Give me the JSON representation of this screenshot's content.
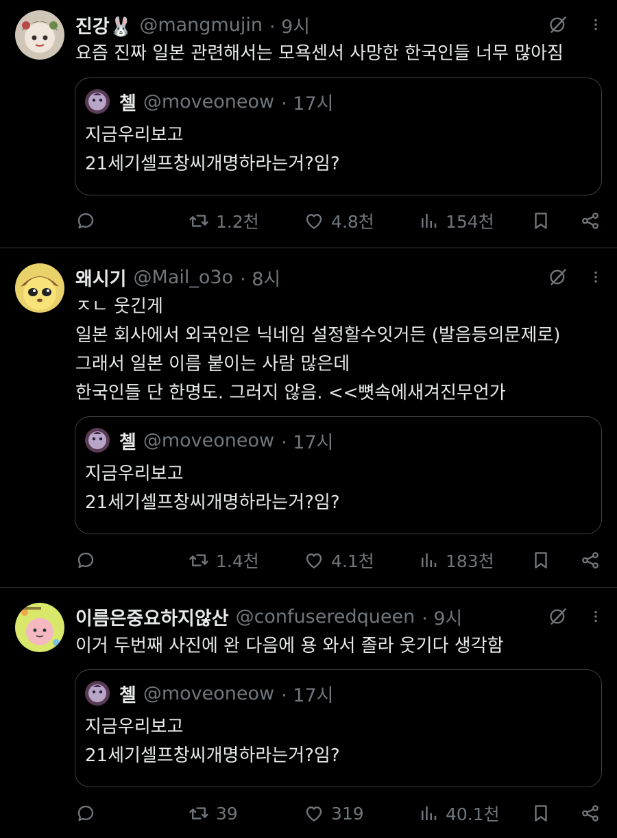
{
  "tweets": [
    {
      "name": "진강🐰",
      "handle": "@mangmujin",
      "time": "· 9시",
      "lines": [
        "요즘 진짜 일본 관련해서는 모욕센서 사망한 한국인들 너무 많아짐"
      ],
      "quote": {
        "name": "첼",
        "handle": "@moveoneow",
        "time": "· 17시",
        "lines": [
          "지금우리보고",
          "21세기셀프창씨개명하라는거?임?"
        ]
      },
      "stats": {
        "retweets": "1.2천",
        "likes": "4.8천",
        "views": "154천"
      }
    },
    {
      "name": "왜시기",
      "handle": "@Mail_o3o",
      "time": "· 8시",
      "lines": [
        "ㅈㄴ 웃긴게",
        "일본 회사에서 외국인은 닉네임 설정할수잇거든 (발음등의문제로)",
        "그래서 일본 이름 붙이는 사람 많은데",
        "한국인들 단 한명도. 그러지 않음. <<뼛속에새겨진무언가"
      ],
      "quote": {
        "name": "첼",
        "handle": "@moveoneow",
        "time": "· 17시",
        "lines": [
          "지금우리보고",
          "21세기셀프창씨개명하라는거?임?"
        ]
      },
      "stats": {
        "retweets": "1.4천",
        "likes": "4.1천",
        "views": "183천"
      }
    },
    {
      "name": "이름은중요하지않산",
      "handle": "@confuseredqueen",
      "time": "· 9시",
      "lines": [
        "이거 두번째 사진에 완 다음에 용 와서 졸라 웃기다 생각함"
      ],
      "quote": {
        "name": "첼",
        "handle": "@moveoneow",
        "time": "· 17시",
        "lines": [
          "지금우리보고",
          "21세기셀프창씨개명하라는거?임?"
        ]
      },
      "stats": {
        "retweets": "39",
        "likes": "319",
        "views": "40.1천"
      }
    }
  ],
  "icons": {
    "grok": "grok-icon",
    "more": "more-options-icon",
    "reply": "reply-icon",
    "retweet": "retweet-icon",
    "like": "like-icon",
    "views": "views-icon",
    "bookmark": "bookmark-icon",
    "share": "share-icon"
  },
  "colors": {
    "background": "#000000",
    "text": "#e7e9ea",
    "secondary": "#71767b",
    "border": "#2f3336"
  }
}
